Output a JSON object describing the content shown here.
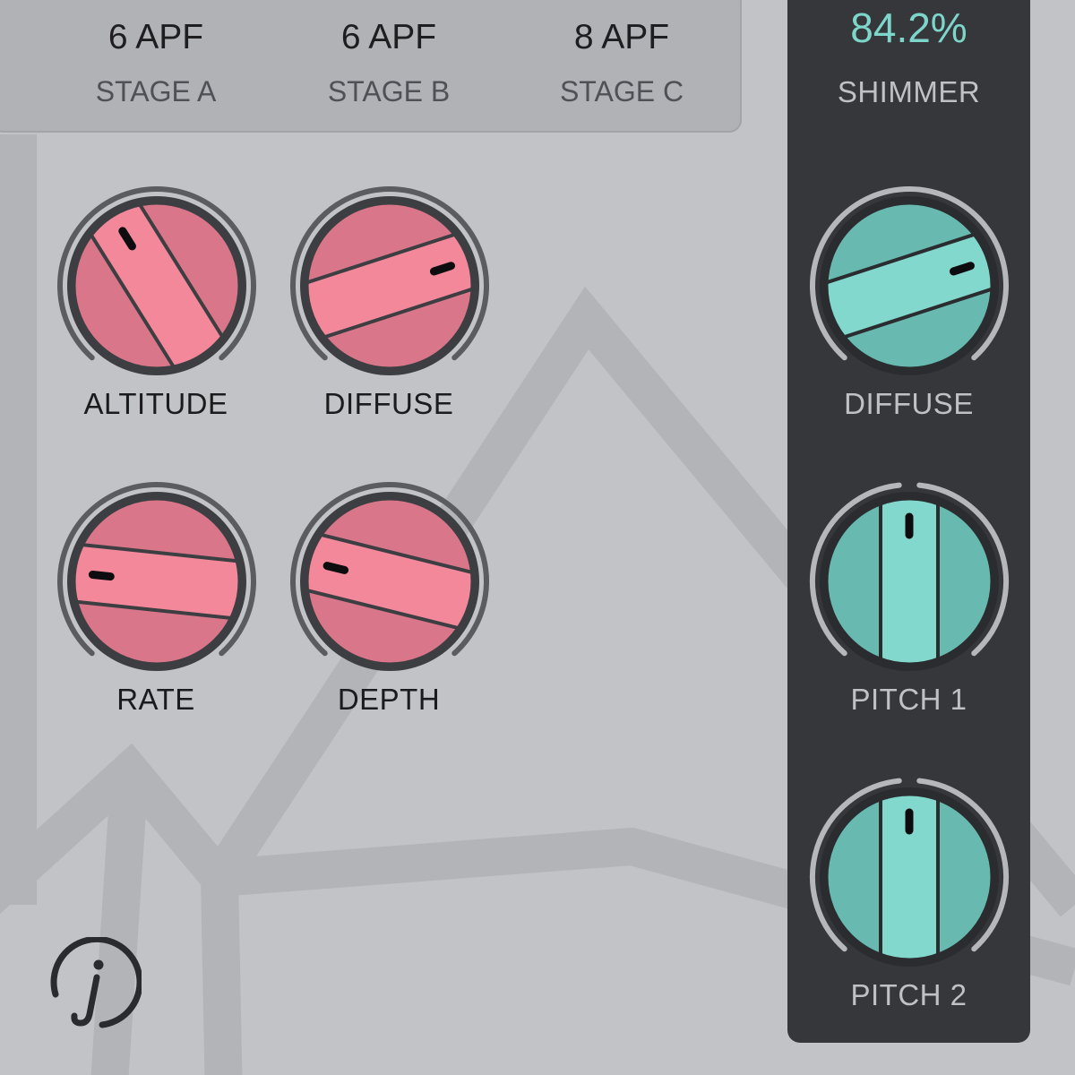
{
  "stages": [
    {
      "value": "6 APF",
      "label": "STAGE A"
    },
    {
      "value": "6 APF",
      "label": "STAGE B"
    },
    {
      "value": "8 APF",
      "label": "STAGE C"
    }
  ],
  "knobs": {
    "altitude": {
      "label": "ALTITUDE"
    },
    "diffuse": {
      "label": "DIFFUSE"
    },
    "rate": {
      "label": "RATE"
    },
    "depth": {
      "label": "DEPTH"
    }
  },
  "shimmer": {
    "value": "84.2%",
    "label": "SHIMMER",
    "diffuse_label": "DIFFUSE",
    "pitch1_label": "PITCH 1",
    "pitch2_label": "PITCH 2"
  },
  "icons": {
    "info": "info-icon"
  },
  "colors": {
    "pink_knob": "#f08796",
    "teal_knob": "#7fd6cc",
    "panel_dark": "#35373b",
    "accent_value": "#7ed6cb"
  }
}
